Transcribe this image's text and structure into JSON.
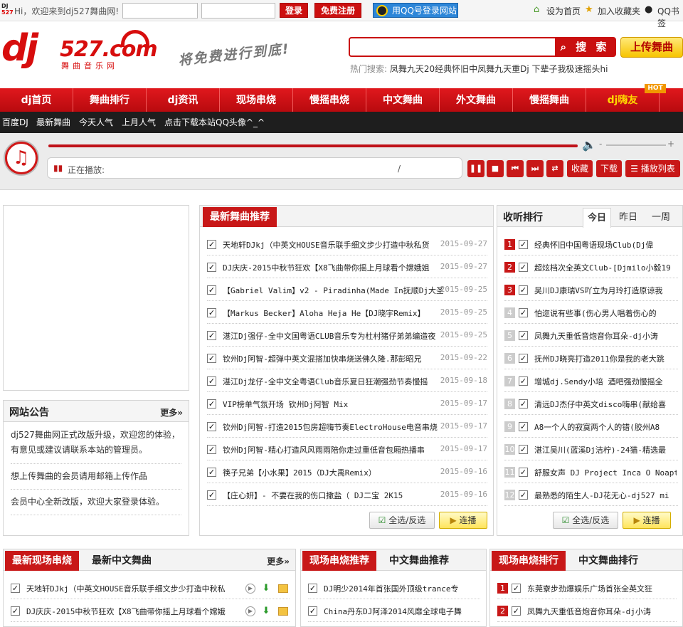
{
  "topbar": {
    "mini_logo_top": "DJ",
    "mini_logo_bottom": "527",
    "welcome": "Hi，欢迎来到dj527舞曲网!",
    "login": "登录",
    "register": "免费注册",
    "qq_login": "用QQ号登录网站",
    "set_home": "设为首页",
    "favorite": "加入收藏夹",
    "qq_bookmark": "QQ书签"
  },
  "header": {
    "logo_dj": "dj",
    "logo_527": "527.com",
    "logo_sub": "舞曲音乐网",
    "slogan": "将免费进行到底!",
    "search_button": "搜 索",
    "search_value": "",
    "upload": "上传舞曲",
    "hot_search_label": "热门搜索:",
    "hot_search_terms": "凤舞九天20经典怀旧中凤舞九天重Dj 下辈子我极速摇头hi"
  },
  "nav": {
    "items": [
      "dj首页",
      "舞曲排行",
      "dj资讯",
      "现场串烧",
      "慢摇串烧",
      "中文舞曲",
      "外文舞曲",
      "慢摇舞曲",
      "dj嗨友"
    ],
    "hot_tag": "HOT"
  },
  "subnav": {
    "items": [
      "百度DJ",
      "最新舞曲",
      "今天人气",
      "上月人气",
      "点击下载本站QQ头像^_^"
    ]
  },
  "player": {
    "now_playing": "正在播放:",
    "separator": "/",
    "favorite": "收藏",
    "download": "下载",
    "playlist": "播放列表",
    "progress": 1.0,
    "controls": [
      "play-pause",
      "stop",
      "previous",
      "next",
      "loop"
    ]
  },
  "notice": {
    "title": "网站公告",
    "more": "更多»",
    "items": [
      "dj527舞曲网正式改版升级，欢迎您的体验，有意见或建议请联系本站的管理员。",
      "想上传舞曲的会员请用邮箱上传作品",
      "会员中心全新改版，欢迎大家登录体验。"
    ]
  },
  "latest": {
    "title": "最新舞曲推荐",
    "songs": [
      {
        "title": "天地轩DJkj（中英文HOUSE音乐联手细文步少打造中秋私货",
        "date": "2015-09-27"
      },
      {
        "title": "DJ庆庆-2015中秋节狂欢【X8飞曲带你摇上月球看个嫦娥姐",
        "date": "2015-09-27"
      },
      {
        "title": "【Gabriel Valim】v2 - Piradinha(Made In抚顺Dj大圣",
        "date": "2015-09-25"
      },
      {
        "title": "【Markus Becker】Aloha Heja He【DJ晓宇Remix】",
        "date": "2015-09-25"
      },
      {
        "title": "湛江Dj强仔-全中文国粤语CLUB音乐专为杜村猪仔弟弟编造夜",
        "date": "2015-09-25"
      },
      {
        "title": "钦州Dj阿智-超弹中英文混搭加快串烧送佛久隆.那彭昭兄",
        "date": "2015-09-22"
      },
      {
        "title": "湛江Dj龙仔-全中文全粤语Club音乐夏日狂潮强劲节奏慢摇",
        "date": "2015-09-18"
      },
      {
        "title": "VIP榜单气氛开场 钦州Dj阿智 Mix",
        "date": "2015-09-17"
      },
      {
        "title": "钦州Dj阿智-打造2015包房超嗨节奏ElectroHouse电音串烧",
        "date": "2015-09-17"
      },
      {
        "title": "钦州Dj阿智-精心打造风风雨雨陪你走过重低音包厢热播串",
        "date": "2015-09-17"
      },
      {
        "title": "筷子兄弟【小水果】2015（DJ大禹Remix）",
        "date": "2015-09-16"
      },
      {
        "title": "【庄心妍】- 不要在我的伤口撒盐（ DJ二宝 2K15",
        "date": "2015-09-16"
      }
    ],
    "select_all": "全选/反选",
    "play": "连播"
  },
  "ranking": {
    "title": "收听排行",
    "tabs": [
      "今日",
      "昨日",
      "一周"
    ],
    "active_tab": "今日",
    "songs": [
      "经典怀旧中国粤语现场Club(Dj偉",
      "超炫档次全英文Club-[Djmilo小毅19",
      "吴川DJ康瑞VS吖立为月玲打造原谅我",
      "怕迩说有些事(伤心男人唱着伤心的",
      "凤舞九天重低音炮音你耳朵-dj小涛",
      "抚州DJ晓亮打造2011你是我的老大跳",
      "增城dj.Sendy小培 酒吧强劲慢摇全",
      "清远DJ杰仔中英文disco嗨串(献给喜",
      "A8一个人的寂寞两个人的错(胶州A8",
      "湛江吴川(蓝溪Dj洁柠)-24猫-精选最",
      "舒服女声 DJ Project Inca O Noapt",
      "最熟悉的陌生人-DJ花无心-dj527 mi"
    ],
    "select_all": "全选/反选",
    "play": "连播"
  },
  "bottom_left": {
    "tab_active": "最新现场串烧",
    "tab_other": "最新中文舞曲",
    "more": "更多»",
    "songs": [
      "天地轩DJkj（中英文HOUSE音乐联手细文步少打造中秋私",
      "DJ庆庆-2015中秋节狂欢【X8飞曲带你摇上月球看个嫦娥"
    ]
  },
  "bottom_mid": {
    "tab_active": "现场串烧推荐",
    "tab_other": "中文舞曲推荐",
    "songs": [
      "DJ明少2014年首张国外顶级trance专",
      "China丹东DJ阿泽2014风靡全球电子舞"
    ]
  },
  "bottom_right": {
    "tab_active": "现场串烧排行",
    "tab_other": "中文舞曲排行",
    "songs": [
      "东莞寮步劲爆娱乐广场首张全英文狂",
      "凤舞九天重低音炮音你耳朵-dj小涛"
    ]
  },
  "colors": {
    "brand_red": "#c81818",
    "nav_red": "#e0181d",
    "highlight_yellow": "#ffd800",
    "subnav_black": "#1e1e1e"
  }
}
